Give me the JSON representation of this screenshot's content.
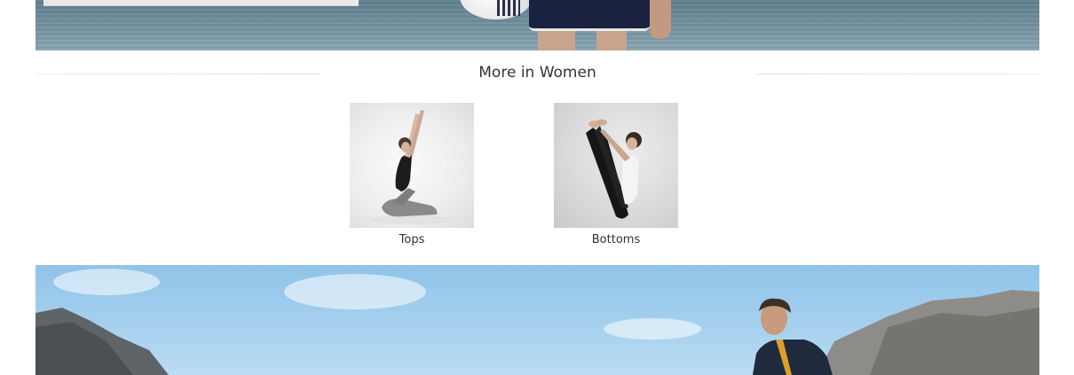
{
  "section": {
    "title": "More in Women"
  },
  "categories": [
    {
      "label": "Tops"
    },
    {
      "label": "Bottoms"
    }
  ],
  "colors": {
    "text": "#333333",
    "rule": "#e6e6e6",
    "sky": "#8fc3e8",
    "sea": "#6e8d9a"
  },
  "icons": {
    "top_banner": "beach-volleyball-image",
    "bottom_banner": "mountain-hiker-image"
  }
}
